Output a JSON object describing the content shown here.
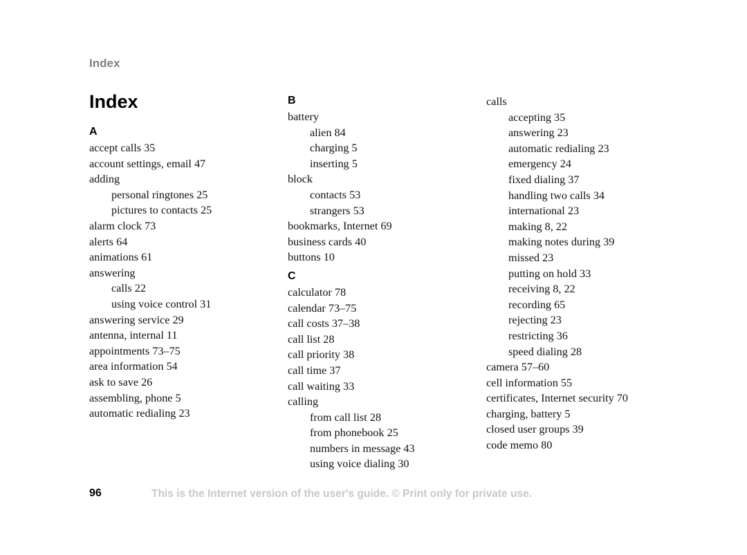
{
  "running_head": "Index",
  "page_title": "Index",
  "columns": [
    [
      {
        "type": "letter",
        "text": "A"
      },
      {
        "type": "entry",
        "text": "accept calls 35"
      },
      {
        "type": "entry",
        "text": "account settings, email 47"
      },
      {
        "type": "entry",
        "text": "adding"
      },
      {
        "type": "sub",
        "text": "personal ringtones 25"
      },
      {
        "type": "sub",
        "text": "pictures to contacts 25"
      },
      {
        "type": "entry",
        "text": "alarm clock 73"
      },
      {
        "type": "entry",
        "text": "alerts 64"
      },
      {
        "type": "entry",
        "text": "animations 61"
      },
      {
        "type": "entry",
        "text": "answering"
      },
      {
        "type": "sub",
        "text": "calls 22"
      },
      {
        "type": "sub",
        "text": "using voice control 31"
      },
      {
        "type": "entry",
        "text": "answering service 29"
      },
      {
        "type": "entry",
        "text": "antenna, internal 11"
      },
      {
        "type": "entry",
        "text": "appointments 73–75"
      },
      {
        "type": "entry",
        "text": "area information 54"
      },
      {
        "type": "entry",
        "text": "ask to save 26"
      },
      {
        "type": "entry",
        "text": "assembling, phone 5"
      },
      {
        "type": "entry",
        "text": "automatic redialing 23"
      }
    ],
    [
      {
        "type": "letter",
        "text": "B"
      },
      {
        "type": "entry",
        "text": "battery"
      },
      {
        "type": "sub",
        "text": "alien 84"
      },
      {
        "type": "sub",
        "text": "charging 5"
      },
      {
        "type": "sub",
        "text": "inserting 5"
      },
      {
        "type": "entry",
        "text": "block"
      },
      {
        "type": "sub",
        "text": "contacts 53"
      },
      {
        "type": "sub",
        "text": "strangers 53"
      },
      {
        "type": "entry",
        "text": "bookmarks, Internet 69"
      },
      {
        "type": "entry",
        "text": "business cards 40"
      },
      {
        "type": "entry",
        "text": "buttons 10"
      },
      {
        "type": "letter",
        "text": "C"
      },
      {
        "type": "entry",
        "text": "calculator 78"
      },
      {
        "type": "entry",
        "text": "calendar 73–75"
      },
      {
        "type": "entry",
        "text": "call costs 37–38"
      },
      {
        "type": "entry",
        "text": "call list 28"
      },
      {
        "type": "entry",
        "text": "call priority 38"
      },
      {
        "type": "entry",
        "text": "call time 37"
      },
      {
        "type": "entry",
        "text": "call waiting 33"
      },
      {
        "type": "entry",
        "text": "calling"
      },
      {
        "type": "sub",
        "text": "from call list 28"
      },
      {
        "type": "sub",
        "text": "from phonebook 25"
      },
      {
        "type": "sub",
        "text": "numbers in message 43"
      },
      {
        "type": "sub",
        "text": "using voice dialing 30"
      }
    ],
    [
      {
        "type": "entry",
        "text": "calls"
      },
      {
        "type": "sub",
        "text": "accepting 35"
      },
      {
        "type": "sub",
        "text": "answering 23"
      },
      {
        "type": "sub",
        "text": "automatic redialing 23"
      },
      {
        "type": "sub",
        "text": "emergency 24"
      },
      {
        "type": "sub",
        "text": "fixed dialing 37"
      },
      {
        "type": "sub",
        "text": "handling two calls 34"
      },
      {
        "type": "sub",
        "text": "international 23"
      },
      {
        "type": "sub",
        "text": "making 8, 22"
      },
      {
        "type": "sub",
        "text": "making notes during 39"
      },
      {
        "type": "sub",
        "text": "missed 23"
      },
      {
        "type": "sub",
        "text": "putting on hold 33"
      },
      {
        "type": "sub",
        "text": "receiving 8, 22"
      },
      {
        "type": "sub",
        "text": "recording 65"
      },
      {
        "type": "sub",
        "text": "rejecting 23"
      },
      {
        "type": "sub",
        "text": "restricting 36"
      },
      {
        "type": "sub",
        "text": "speed dialing 28"
      },
      {
        "type": "entry",
        "text": "camera 57–60"
      },
      {
        "type": "entry",
        "text": "cell information 55"
      },
      {
        "type": "entry",
        "text": "certificates, Internet security 70"
      },
      {
        "type": "entry",
        "text": "charging, battery 5"
      },
      {
        "type": "entry",
        "text": "closed user groups 39"
      },
      {
        "type": "entry",
        "text": "code memo 80"
      }
    ]
  ],
  "footer": {
    "page_number": "96",
    "note": "This is the Internet version of the user's guide. © Print only for private use."
  }
}
